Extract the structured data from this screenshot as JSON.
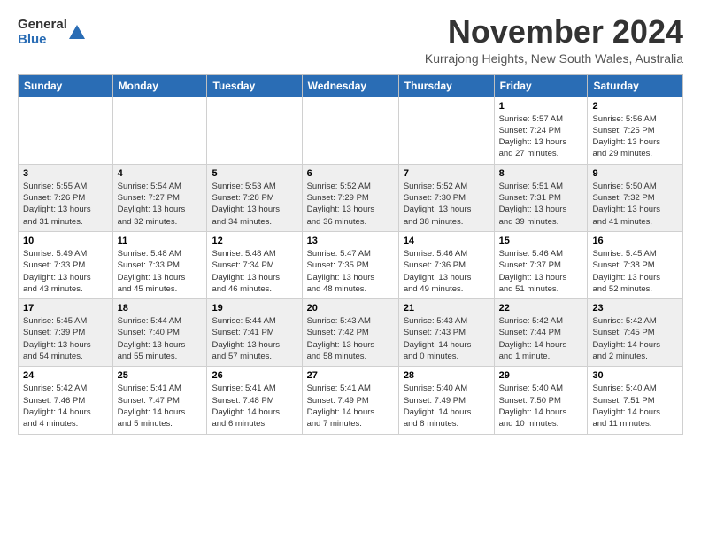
{
  "logo": {
    "line1": "General",
    "line2": "Blue"
  },
  "header": {
    "title": "November 2024",
    "location": "Kurrajong Heights, New South Wales, Australia"
  },
  "weekdays": [
    "Sunday",
    "Monday",
    "Tuesday",
    "Wednesday",
    "Thursday",
    "Friday",
    "Saturday"
  ],
  "weeks": [
    [
      {
        "day": "",
        "info": ""
      },
      {
        "day": "",
        "info": ""
      },
      {
        "day": "",
        "info": ""
      },
      {
        "day": "",
        "info": ""
      },
      {
        "day": "",
        "info": ""
      },
      {
        "day": "1",
        "info": "Sunrise: 5:57 AM\nSunset: 7:24 PM\nDaylight: 13 hours\nand 27 minutes."
      },
      {
        "day": "2",
        "info": "Sunrise: 5:56 AM\nSunset: 7:25 PM\nDaylight: 13 hours\nand 29 minutes."
      }
    ],
    [
      {
        "day": "3",
        "info": "Sunrise: 5:55 AM\nSunset: 7:26 PM\nDaylight: 13 hours\nand 31 minutes."
      },
      {
        "day": "4",
        "info": "Sunrise: 5:54 AM\nSunset: 7:27 PM\nDaylight: 13 hours\nand 32 minutes."
      },
      {
        "day": "5",
        "info": "Sunrise: 5:53 AM\nSunset: 7:28 PM\nDaylight: 13 hours\nand 34 minutes."
      },
      {
        "day": "6",
        "info": "Sunrise: 5:52 AM\nSunset: 7:29 PM\nDaylight: 13 hours\nand 36 minutes."
      },
      {
        "day": "7",
        "info": "Sunrise: 5:52 AM\nSunset: 7:30 PM\nDaylight: 13 hours\nand 38 minutes."
      },
      {
        "day": "8",
        "info": "Sunrise: 5:51 AM\nSunset: 7:31 PM\nDaylight: 13 hours\nand 39 minutes."
      },
      {
        "day": "9",
        "info": "Sunrise: 5:50 AM\nSunset: 7:32 PM\nDaylight: 13 hours\nand 41 minutes."
      }
    ],
    [
      {
        "day": "10",
        "info": "Sunrise: 5:49 AM\nSunset: 7:33 PM\nDaylight: 13 hours\nand 43 minutes."
      },
      {
        "day": "11",
        "info": "Sunrise: 5:48 AM\nSunset: 7:33 PM\nDaylight: 13 hours\nand 45 minutes."
      },
      {
        "day": "12",
        "info": "Sunrise: 5:48 AM\nSunset: 7:34 PM\nDaylight: 13 hours\nand 46 minutes."
      },
      {
        "day": "13",
        "info": "Sunrise: 5:47 AM\nSunset: 7:35 PM\nDaylight: 13 hours\nand 48 minutes."
      },
      {
        "day": "14",
        "info": "Sunrise: 5:46 AM\nSunset: 7:36 PM\nDaylight: 13 hours\nand 49 minutes."
      },
      {
        "day": "15",
        "info": "Sunrise: 5:46 AM\nSunset: 7:37 PM\nDaylight: 13 hours\nand 51 minutes."
      },
      {
        "day": "16",
        "info": "Sunrise: 5:45 AM\nSunset: 7:38 PM\nDaylight: 13 hours\nand 52 minutes."
      }
    ],
    [
      {
        "day": "17",
        "info": "Sunrise: 5:45 AM\nSunset: 7:39 PM\nDaylight: 13 hours\nand 54 minutes."
      },
      {
        "day": "18",
        "info": "Sunrise: 5:44 AM\nSunset: 7:40 PM\nDaylight: 13 hours\nand 55 minutes."
      },
      {
        "day": "19",
        "info": "Sunrise: 5:44 AM\nSunset: 7:41 PM\nDaylight: 13 hours\nand 57 minutes."
      },
      {
        "day": "20",
        "info": "Sunrise: 5:43 AM\nSunset: 7:42 PM\nDaylight: 13 hours\nand 58 minutes."
      },
      {
        "day": "21",
        "info": "Sunrise: 5:43 AM\nSunset: 7:43 PM\nDaylight: 14 hours\nand 0 minutes."
      },
      {
        "day": "22",
        "info": "Sunrise: 5:42 AM\nSunset: 7:44 PM\nDaylight: 14 hours\nand 1 minute."
      },
      {
        "day": "23",
        "info": "Sunrise: 5:42 AM\nSunset: 7:45 PM\nDaylight: 14 hours\nand 2 minutes."
      }
    ],
    [
      {
        "day": "24",
        "info": "Sunrise: 5:42 AM\nSunset: 7:46 PM\nDaylight: 14 hours\nand 4 minutes."
      },
      {
        "day": "25",
        "info": "Sunrise: 5:41 AM\nSunset: 7:47 PM\nDaylight: 14 hours\nand 5 minutes."
      },
      {
        "day": "26",
        "info": "Sunrise: 5:41 AM\nSunset: 7:48 PM\nDaylight: 14 hours\nand 6 minutes."
      },
      {
        "day": "27",
        "info": "Sunrise: 5:41 AM\nSunset: 7:49 PM\nDaylight: 14 hours\nand 7 minutes."
      },
      {
        "day": "28",
        "info": "Sunrise: 5:40 AM\nSunset: 7:49 PM\nDaylight: 14 hours\nand 8 minutes."
      },
      {
        "day": "29",
        "info": "Sunrise: 5:40 AM\nSunset: 7:50 PM\nDaylight: 14 hours\nand 10 minutes."
      },
      {
        "day": "30",
        "info": "Sunrise: 5:40 AM\nSunset: 7:51 PM\nDaylight: 14 hours\nand 11 minutes."
      }
    ]
  ]
}
